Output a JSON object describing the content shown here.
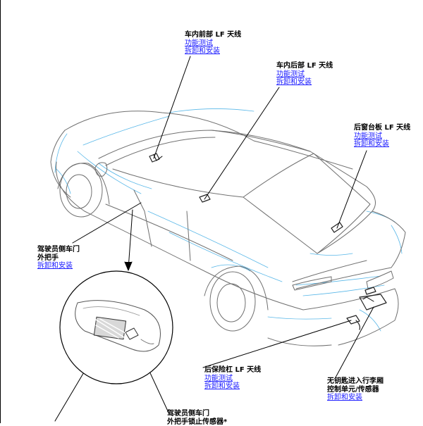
{
  "callouts": {
    "front_interior_antenna": {
      "title": "车内前部 LF 天线",
      "links": [
        "功能测试",
        "拆卸和安装"
      ]
    },
    "rear_interior_antenna": {
      "title": "车内后部 LF 天线",
      "links": [
        "功能测试",
        "拆卸和安装"
      ]
    },
    "rear_tray_antenna": {
      "title": "后窗台板 LF 天线",
      "links": [
        "功能测试",
        "拆卸和安装"
      ]
    },
    "driver_door_handle": {
      "title_lines": [
        "驾驶员侧车门",
        "外把手"
      ],
      "links": [
        "拆卸和安装"
      ]
    },
    "rear_bumper_antenna": {
      "title": "后保险杠 LF 天线",
      "links": [
        "功能测试",
        "拆卸和安装"
      ]
    },
    "keyless_trunk_unit": {
      "title_lines": [
        "无钥匙进入行李厢",
        "控制单元/传感器"
      ],
      "links": [
        "拆卸和安装"
      ]
    },
    "driver_door_sensor": {
      "title_lines": [
        "驾驶员侧车门",
        "外把手锁止传感器*"
      ]
    }
  },
  "colors": {
    "link": "#1a1aff",
    "outline": "#6f6f6f",
    "blue_lines": "#58b7e8"
  }
}
